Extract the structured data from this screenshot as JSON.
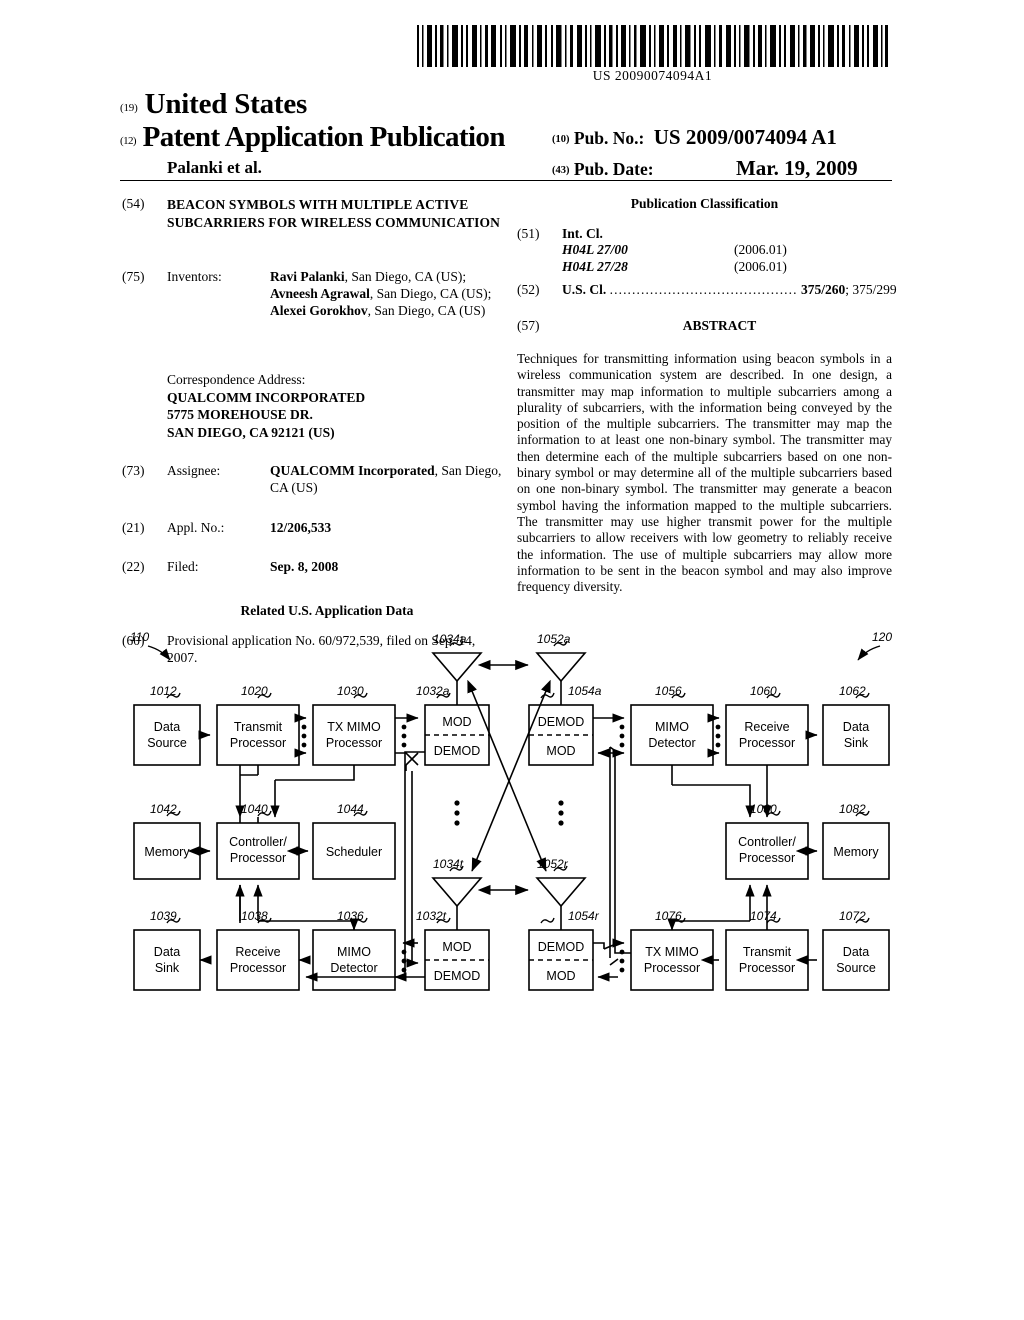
{
  "barcode": {
    "number": "US 20090074094A1"
  },
  "masthead": {
    "code19": "(19)",
    "country": "United States",
    "code12": "(12)",
    "doc_type": "Patent Application Publication",
    "authors": "Palanki et al.",
    "code10": "(10)",
    "pubno_label": "Pub. No.:",
    "pubno_value": "US 2009/0074094 A1",
    "code43": "(43)",
    "pubdate_label": "Pub. Date:",
    "pubdate_value": "Mar. 19, 2009"
  },
  "left": {
    "title_tag": "(54)",
    "title": "BEACON SYMBOLS WITH MULTIPLE ACTIVE SUBCARRIERS FOR WIRELESS COMMUNICATION",
    "inventors_tag": "(75)",
    "inventors_label": "Inventors:",
    "inventors": [
      {
        "name": "Ravi Palanki",
        "loc": ", San Diego, CA (US);"
      },
      {
        "name": "Avneesh Agrawal",
        "loc": ", San Diego, CA (US); "
      },
      {
        "name": "Alexei Gorokhov",
        "loc": ", San Diego, CA (US)"
      }
    ],
    "correspondence_label": "Correspondence Address:",
    "correspondence": [
      "QUALCOMM INCORPORATED",
      "5775 MOREHOUSE DR.",
      "SAN DIEGO, CA 92121 (US)"
    ],
    "assignee_tag": "(73)",
    "assignee_label": "Assignee:",
    "assignee_name": "QUALCOMM Incorporated",
    "assignee_rest": ", San Diego, CA (US)",
    "appl_tag": "(21)",
    "appl_label": "Appl. No.:",
    "appl_value": "12/206,533",
    "filed_tag": "(22)",
    "filed_label": "Filed:",
    "filed_value": "Sep. 8, 2008",
    "related_header": "Related U.S. Application Data",
    "prov_tag": "(60)",
    "prov_text": "Provisional application No. 60/972,539, filed on Sep. 14, 2007."
  },
  "right": {
    "pubclass_header": "Publication Classification",
    "intcl_tag": "(51)",
    "intcl_label": "Int. Cl.",
    "intcl_rows": [
      {
        "code": "H04L 27/00",
        "year": "(2006.01)"
      },
      {
        "code": "H04L 27/28",
        "year": "(2006.01)"
      }
    ],
    "uscl_tag": "(52)",
    "uscl_label": "U.S. Cl.",
    "uscl_dots": "..........................................",
    "uscl_primary": "375/260",
    "uscl_rest": "; 375/299",
    "abstract_tag": "(57)",
    "abstract_header": "ABSTRACT",
    "abstract_text": "Techniques for transmitting information using beacon symbols in a wireless communication system are described. In one design, a transmitter may map information to multiple subcarriers among a plurality of subcarriers, with the information being conveyed by the position of the multiple subcarriers. The transmitter may map the information to at least one non-binary symbol. The transmitter may then determine each of the multiple subcarriers based on one non-binary symbol or may determine all of the multiple subcarriers based on one non-binary symbol. The transmitter may generate a beacon symbol having the information mapped to the multiple subcarriers. The transmitter may use higher transmit power for the multiple subcarriers to allow receivers with low geometry to reliably receive the information. The use of multiple subcarriers may allow more information to be sent in the beacon symbol and may also improve frequency diversity."
  },
  "figure": {
    "system_labels": {
      "left": "110",
      "right": "120"
    },
    "blocks": [
      {
        "id": "b1012",
        "ref": "1012",
        "lines": [
          "Data",
          "Source"
        ]
      },
      {
        "id": "b1020",
        "ref": "1020",
        "lines": [
          "Transmit",
          "Processor"
        ]
      },
      {
        "id": "b1030",
        "ref": "1030",
        "lines": [
          "TX MIMO",
          "Processor"
        ]
      },
      {
        "id": "b1032a",
        "ref": "1032a",
        "lines": [
          "MOD",
          "DEMOD"
        ]
      },
      {
        "id": "b1054a",
        "ref": "1054a",
        "lines": [
          "DEMOD",
          "MOD"
        ]
      },
      {
        "id": "b1056",
        "ref": "1056",
        "lines": [
          "MIMO",
          "Detector"
        ]
      },
      {
        "id": "b1060",
        "ref": "1060",
        "lines": [
          "Receive",
          "Processor"
        ]
      },
      {
        "id": "b1062",
        "ref": "1062",
        "lines": [
          "Data",
          "Sink"
        ]
      },
      {
        "id": "b1042",
        "ref": "1042",
        "lines": [
          "Memory"
        ]
      },
      {
        "id": "b1040",
        "ref": "1040",
        "lines": [
          "Controller/",
          "Processor"
        ]
      },
      {
        "id": "b1044",
        "ref": "1044",
        "lines": [
          "Scheduler"
        ]
      },
      {
        "id": "b1080",
        "ref": "1080",
        "lines": [
          "Controller/",
          "Processor"
        ]
      },
      {
        "id": "b1082",
        "ref": "1082",
        "lines": [
          "Memory"
        ]
      },
      {
        "id": "b1039",
        "ref": "1039",
        "lines": [
          "Data",
          "Sink"
        ]
      },
      {
        "id": "b1038",
        "ref": "1038",
        "lines": [
          "Receive",
          "Processor"
        ]
      },
      {
        "id": "b1036",
        "ref": "1036",
        "lines": [
          "MIMO",
          "Detector"
        ]
      },
      {
        "id": "b1032t",
        "ref": "1032t",
        "lines": [
          "MOD",
          "DEMOD"
        ]
      },
      {
        "id": "b1054r",
        "ref": "1054r",
        "lines": [
          "DEMOD",
          "MOD"
        ]
      },
      {
        "id": "b1076",
        "ref": "1076",
        "lines": [
          "TX MIMO",
          "Processor"
        ]
      },
      {
        "id": "b1074",
        "ref": "1074",
        "lines": [
          "Transmit",
          "Processor"
        ]
      },
      {
        "id": "b1072",
        "ref": "1072",
        "lines": [
          "Data",
          "Source"
        ]
      }
    ],
    "antennas": [
      {
        "id": "a1034a",
        "ref": "1034a"
      },
      {
        "id": "a1052a",
        "ref": "1052a"
      },
      {
        "id": "a1034t",
        "ref": "1034t"
      },
      {
        "id": "a1052r",
        "ref": "1052r"
      }
    ]
  }
}
